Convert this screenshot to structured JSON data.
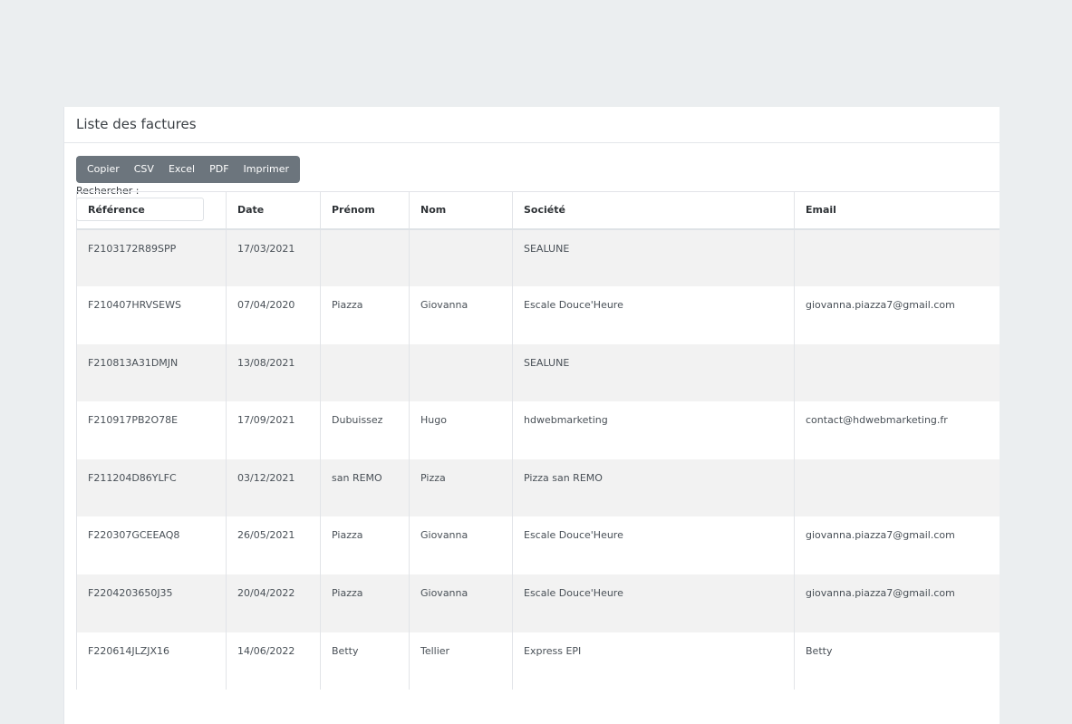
{
  "card": {
    "title": "Liste des factures"
  },
  "toolbar": {
    "copy_label": "Copier",
    "csv_label": "CSV",
    "excel_label": "Excel",
    "pdf_label": "PDF",
    "print_label": "Imprimer"
  },
  "search": {
    "label": "Rechercher :",
    "value": "",
    "placeholder": ""
  },
  "table": {
    "headers": [
      "Référence",
      "Date",
      "Prénom",
      "Nom",
      "Société",
      "Email"
    ],
    "rows": [
      [
        "F2103172R89SPP",
        "17/03/2021",
        "",
        "",
        "SEALUNE",
        ""
      ],
      [
        "F210407HRVSEWS",
        "07/04/2020",
        "Piazza",
        "Giovanna",
        "Escale Douce'Heure",
        "giovanna.piazza7@gmail.com"
      ],
      [
        "F210813A31DMJN",
        "13/08/2021",
        "",
        "",
        "SEALUNE",
        ""
      ],
      [
        "F210917PB2O78E",
        "17/09/2021",
        "Dubuissez",
        "Hugo",
        "hdwebmarketing",
        "contact@hdwebmarketing.fr"
      ],
      [
        "F211204D86YLFC",
        "03/12/2021",
        "san REMO",
        "Pizza",
        "Pizza san REMO",
        ""
      ],
      [
        "F220307GCEEAQ8",
        "26/05/2021",
        "Piazza",
        "Giovanna",
        "Escale Douce'Heure",
        "giovanna.piazza7@gmail.com"
      ],
      [
        "F2204203650J35",
        "20/04/2022",
        "Piazza",
        "Giovanna",
        "Escale Douce'Heure",
        "giovanna.piazza7@gmail.com"
      ],
      [
        "F220614JLZJX16",
        "14/06/2022",
        "Betty",
        "Tellier",
        "Express EPI",
        "Betty"
      ]
    ]
  },
  "colors": {
    "background": "#ebeef0",
    "button_group": "#6c757d",
    "row_stripe": "#f2f2f2"
  }
}
